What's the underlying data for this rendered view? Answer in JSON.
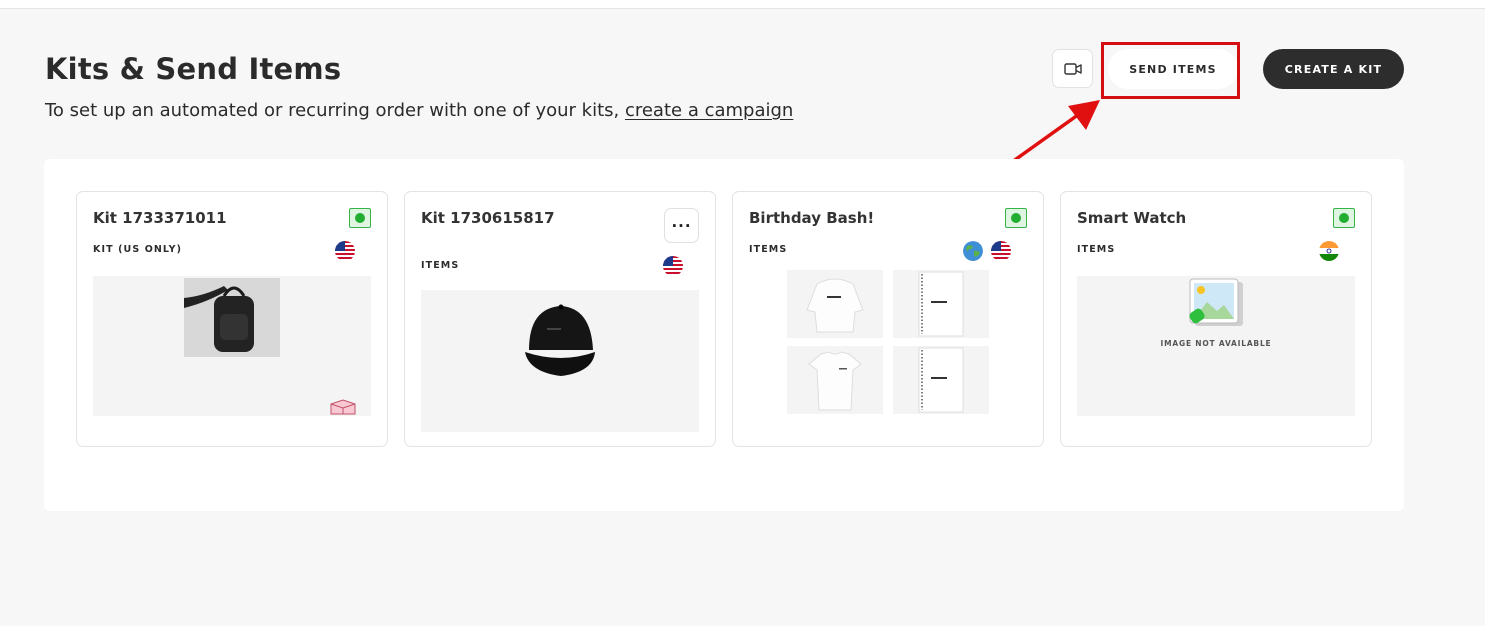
{
  "header": {
    "title": "Kits & Send Items",
    "subtitle_prefix": "To set up an automated or recurring order with one of your kits, ",
    "subtitle_link": "create a campaign",
    "send_items_label": "SEND ITEMS",
    "create_kit_label": "CREATE A KIT",
    "video_icon": "video-camera-icon"
  },
  "colors": {
    "highlight": "#d40f14",
    "status_active": "#1fae2f",
    "dark_button": "#2d2d2d"
  },
  "kits": [
    {
      "name": "Kit 1733371011",
      "type": "KIT (US ONLY)",
      "status": "active",
      "flags": [
        "us-flag"
      ],
      "image": "black-backpack"
    },
    {
      "name": "Kit 1730615817",
      "type": "ITEMS",
      "status": "menu",
      "flags": [
        "us-flag"
      ],
      "image": "black-cap"
    },
    {
      "name": "Birthday Bash!",
      "type": "ITEMS",
      "status": "active",
      "flags": [
        "globe-icon",
        "us-flag"
      ],
      "image": "hoodie-notebook-tshirt-notebook"
    },
    {
      "name": "Smart Watch",
      "type": "ITEMS",
      "status": "active",
      "flags": [
        "india-flag"
      ],
      "image": "placeholder",
      "image_text": "IMAGE NOT AVAILABLE"
    }
  ]
}
